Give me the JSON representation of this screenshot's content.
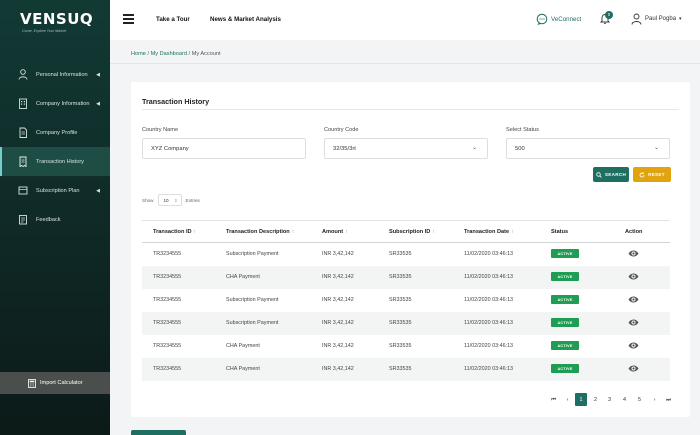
{
  "brand": {
    "name": "VENSUQ",
    "tagline": "Come, Explore Your Market"
  },
  "sidebar": {
    "items": [
      {
        "label": "Personal Information",
        "icon": "person-icon",
        "has_arrow": true
      },
      {
        "label": "Company Information",
        "icon": "building-icon",
        "has_arrow": true
      },
      {
        "label": "Company Profile",
        "icon": "document-icon",
        "has_arrow": false
      },
      {
        "label": "Transaction History",
        "icon": "receipt-icon",
        "has_arrow": false,
        "active": true
      },
      {
        "label": "Subscription Plan",
        "icon": "subscription-icon",
        "has_arrow": true
      },
      {
        "label": "Feedback",
        "icon": "feedback-icon",
        "has_arrow": false
      }
    ],
    "arrow": "◀",
    "import_calculator": "Import Calculator"
  },
  "header": {
    "take_tour": "Take a Tour",
    "news": "News & Market Analysis",
    "veconnect": "VeConnect",
    "notifications_count": "0",
    "user_name": "Paul Pogba",
    "user_caret": "▾"
  },
  "breadcrumb": {
    "home": "Home",
    "dashboard": "My Dashboard",
    "current": "My Account",
    "sep": "/"
  },
  "card": {
    "title": "Transaction History",
    "filters": {
      "country_name_label": "Country Name",
      "country_name_value": "XYZ Company",
      "country_code_label": "Country Code",
      "country_code_value": "32/35/3rt",
      "status_label": "Select Status",
      "status_value": "500",
      "caret": "⌄"
    },
    "search_label": "SEARCH",
    "reset_label": "RESET",
    "show_label": "Show",
    "show_value": "10",
    "entries_label": "Entries",
    "table": {
      "sort_glyph": "↑",
      "columns": [
        "Transaction ID",
        "Transaction Description",
        "Amount",
        "Subscription ID",
        "Transaction Date",
        "Status",
        "Action"
      ],
      "rows": [
        {
          "id": "TR3234555",
          "desc": "Subscription Payment",
          "amount": "INR 3,42,142",
          "sub_id": "SR33535",
          "date": "11/02/2020 03:46:13",
          "status": "ACTIVE"
        },
        {
          "id": "TR3234555",
          "desc": "CHA Payment",
          "amount": "INR 3,42,142",
          "sub_id": "SR33535",
          "date": "11/02/2020 03:46:13",
          "status": "ACTIVE"
        },
        {
          "id": "TR3234555",
          "desc": "Subscription Payment",
          "amount": "INR 3,42,142",
          "sub_id": "SR33535",
          "date": "11/02/2020 03:46:13",
          "status": "ACTIVE"
        },
        {
          "id": "TR3234555",
          "desc": "Subscription Payment",
          "amount": "INR 3,42,142",
          "sub_id": "SR33535",
          "date": "11/02/2020 03:46:13",
          "status": "ACTIVE"
        },
        {
          "id": "TR3234555",
          "desc": "CHA Payment",
          "amount": "INR 3,42,142",
          "sub_id": "SR33535",
          "date": "11/02/2020 03:46:13",
          "status": "ACTIVE"
        },
        {
          "id": "TR3234555",
          "desc": "CHA Payment",
          "amount": "INR 3,42,142",
          "sub_id": "SR33535",
          "date": "11/02/2020 03:46:13",
          "status": "ACTIVE"
        }
      ]
    },
    "pagination": {
      "first": "⏮",
      "prev": "‹",
      "next": "›",
      "last": "⏭",
      "pages": [
        "1",
        "2",
        "3",
        "4",
        "5"
      ],
      "current": "1"
    }
  },
  "colors": {
    "accent": "#1f6e62",
    "reset": "#e0a411",
    "active_badge": "#1f9d55",
    "sidebar": "#123a35"
  }
}
